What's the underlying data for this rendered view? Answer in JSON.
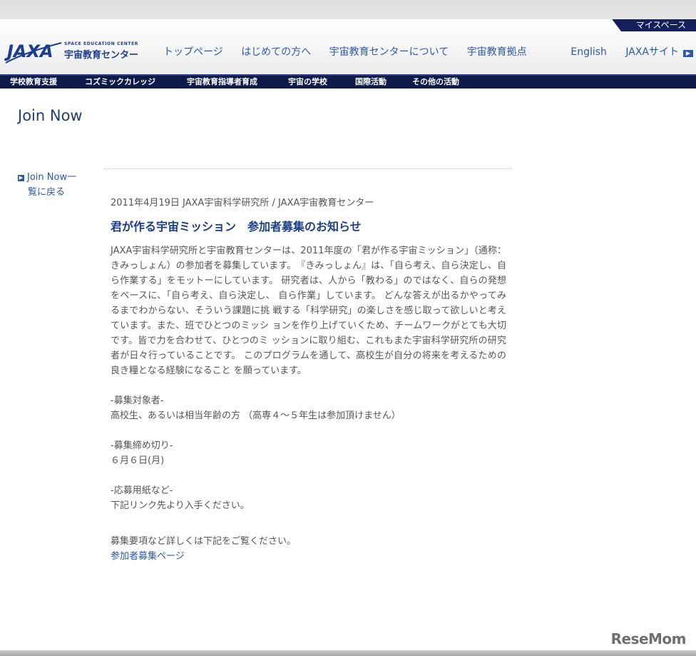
{
  "header": {
    "myspace_label": "マイスペース",
    "logo_text": "JAXA",
    "logo_sub": "SPACE EDUCATION CENTER",
    "logo_name": "宇宙教育センター",
    "nav": [
      "トップページ",
      "はじめての方へ",
      "宇宙教育センターについて",
      "宇宙教育拠点"
    ],
    "right_nav": [
      "English",
      "JAXAサイト"
    ],
    "subnav": [
      "学校教育支援",
      "コズミックカレッジ",
      "宇宙教育指導者育成",
      "宇宙の学校",
      "国際活動",
      "その他の活動"
    ]
  },
  "page": {
    "title": "Join Now",
    "back_link_line1": "Join Now一",
    "back_link_line2": "覧に戻る"
  },
  "article": {
    "dateline": "2011年4月19日 JAXA宇宙科学研究所 / JAXA宇宙教育センター",
    "headline": "君が作る宇宙ミッション　参加者募集のお知らせ",
    "body": "JAXA宇宙科学研究所と宇宙教育センターは、2011年度の「君が作る宇宙ミッション」（通称：きみっしょん）の参加者を募集しています。　『きみっしょん』は、「自ら考え、自ら決定し、自ら作業する」をモットーにしています。 研究者は、人から「教わる」のではなく、自らの発想をベースに、「自ら考え、自ら決定し、 自ら作業」しています。 どんな答えが出るかやってみるまでわからない、そういう課題に挑 戦する「科学研究」の楽しさを感じ取って欲しいと考えています。また、班でひとつのミッシ ョンを作り上げていくため、チームワークがとても大切です。皆で力を合わせて、ひとつのミ ッションに取り組む、これもまた宇宙科学研究所の研究者が日々行っていることです。 このプログラムを通して、高校生が自分の将来を考えるための良き糧となる経験になること を願っています。",
    "target_label": "-募集対象者-",
    "target_value": "高校生、あるいは相当年齢の方 （高専４～５年生は参加頂けません）",
    "deadline_label": "-募集締め切り-",
    "deadline_value": "６月６日(月)",
    "form_label": "-応募用紙など-",
    "form_value": "下記リンク先より入手ください。",
    "details_text": "募集要項など詳しくは下記をご覧ください。",
    "details_link": "参加者募集ページ"
  },
  "watermark": "ReseMom"
}
